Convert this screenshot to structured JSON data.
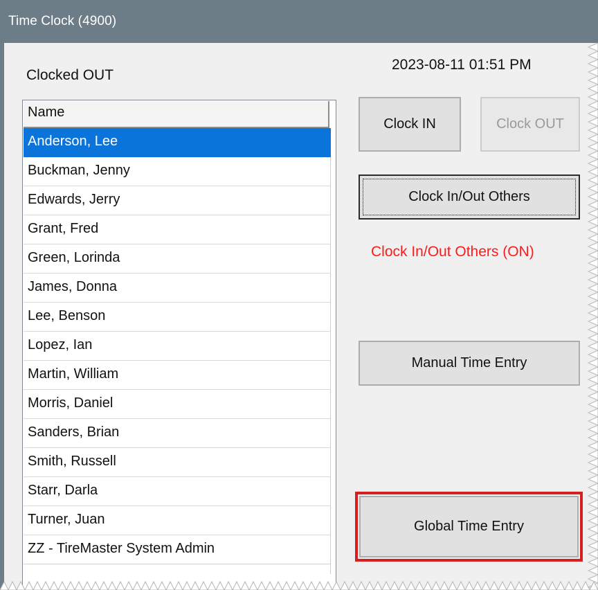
{
  "window": {
    "title": "Time Clock (4900)"
  },
  "datetime": "2023-08-11 01:51 PM",
  "status": "Clocked OUT",
  "employee_list": {
    "header": "Name",
    "rows": [
      "Anderson, Lee",
      "Buckman, Jenny",
      "Edwards, Jerry",
      "Grant, Fred",
      "Green, Lorinda",
      "James, Donna",
      "Lee, Benson",
      "Lopez, Ian",
      "Martin, William",
      "Morris, Daniel",
      "Sanders, Brian",
      "Smith, Russell",
      "Starr, Darla",
      "Turner, Juan",
      "ZZ - TireMaster System Admin"
    ],
    "selected_index": 0
  },
  "buttons": {
    "clock_in": "Clock IN",
    "clock_out": "Clock OUT",
    "clock_in_out_others": "Clock In/Out Others",
    "manual_time_entry": "Manual Time Entry",
    "global_time_entry": "Global Time Entry"
  },
  "others_status": "Clock In/Out Others (ON)",
  "colors": {
    "titlebar": "#6d7d88",
    "selection": "#0a74da",
    "highlight": "#d62020",
    "status_red": "#ff1a1a"
  }
}
